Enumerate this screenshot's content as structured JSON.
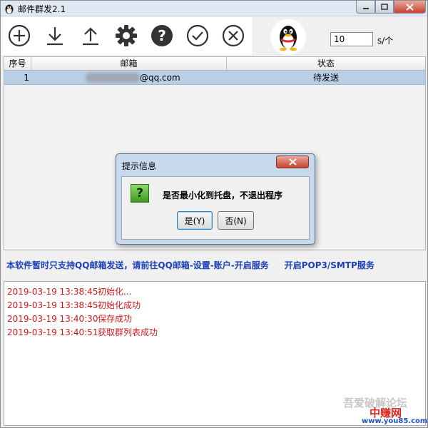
{
  "window": {
    "title": "邮件群发2.1",
    "icon": "qq-penguin-icon"
  },
  "toolbar": {
    "icons": [
      "add-icon",
      "download-icon",
      "upload-icon",
      "settings-gear-icon",
      "help-icon",
      "check-icon",
      "cancel-icon"
    ]
  },
  "interval": {
    "value": "10",
    "unit": "s/个"
  },
  "table": {
    "columns": [
      "序号",
      "邮箱",
      "状态"
    ],
    "rows": [
      {
        "index": "1",
        "email": "@qq.com",
        "status": "待发送"
      }
    ]
  },
  "notice": {
    "text": "本软件暂时只支持QQ邮箱发送，请前往QQ邮箱-设置-账户-开启服务",
    "text2": "开启POP3/SMTP服务"
  },
  "log": [
    {
      "time": "2019-03-19 13:38:45",
      "message": "初始化..."
    },
    {
      "time": "2019-03-19 13:38:45",
      "message": "初始化成功"
    },
    {
      "time": "2019-03-19 13:40:30",
      "message": "保存成功"
    },
    {
      "time": "2019-03-19 13:40:51",
      "message": "获取群列表成功"
    }
  ],
  "dialog": {
    "title": "提示信息",
    "message": "是否最小化到托盘，不退出程序",
    "yes_label": "是(Y)",
    "no_label": "否(N)",
    "icon": "question-icon"
  },
  "watermark": {
    "line1": "吾爱破解论坛",
    "line2": "中赚网",
    "line3": "www.you85.com"
  },
  "colors": {
    "log_text": "#d01a1a",
    "notice_text": "#1a3fb8",
    "selected_row": "#b9cfe6"
  }
}
